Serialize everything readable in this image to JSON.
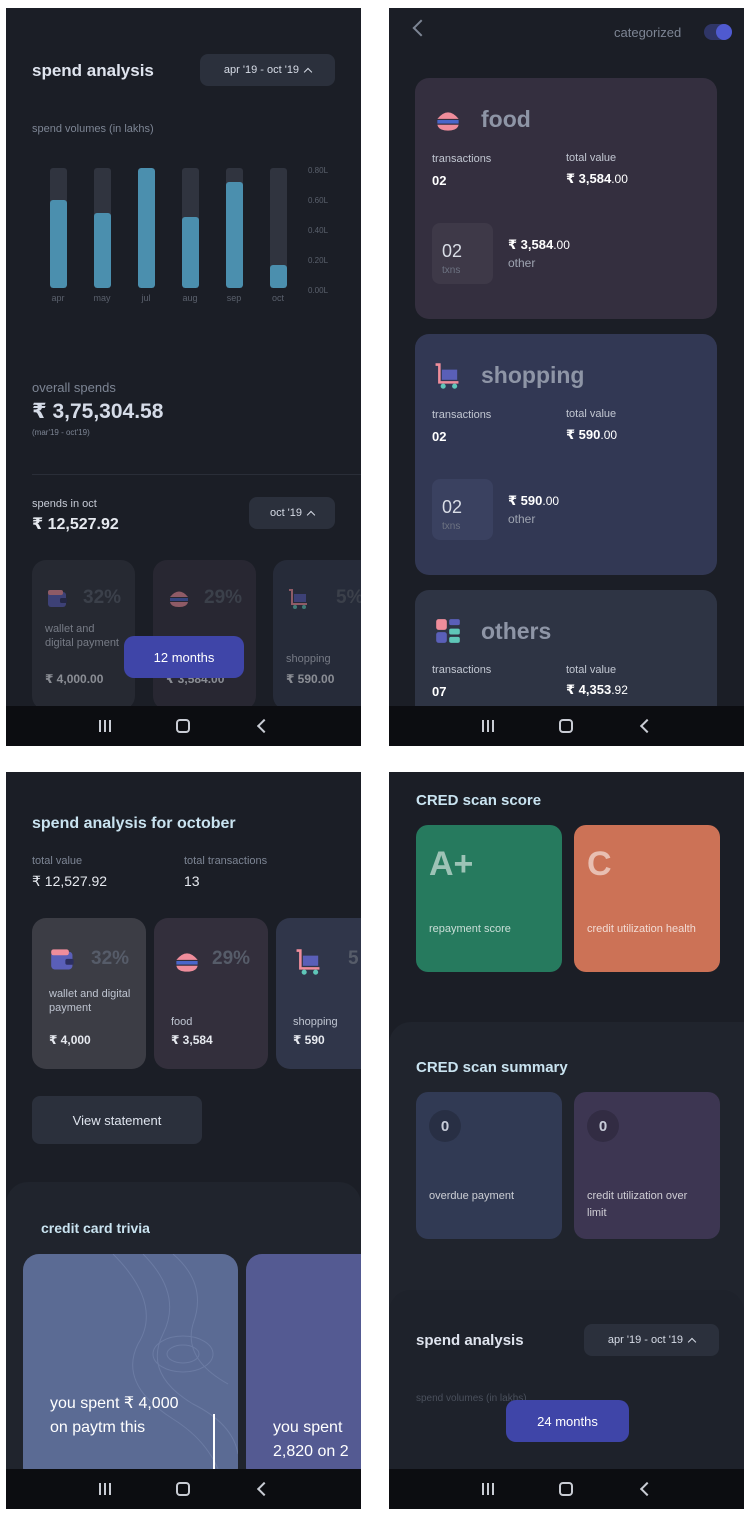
{
  "screen1": {
    "title": "spend analysis",
    "range_pill": "apr '19 - oct '19",
    "chart_label": "spend volumes (in lakhs)",
    "overall_label": "overall spends",
    "overall_value": "₹ 3,75,304.58",
    "overall_range": "(mar'19 - oct'19)",
    "month_label": "spends in oct",
    "month_value": "₹ 12,527.92",
    "month_pill": "oct '19",
    "categories": [
      {
        "pct": "32%",
        "name": "wallet and digital payment",
        "value": "₹ 4,000.00"
      },
      {
        "pct": "29%",
        "name": "food",
        "value": "₹ 3,584.00"
      },
      {
        "pct": "5%",
        "name": "shopping",
        "value": "₹ 590.00"
      }
    ],
    "float_button": "12 months"
  },
  "chart_data": {
    "type": "bar",
    "categories": [
      "apr",
      "may",
      "jul",
      "aug",
      "sep",
      "oct"
    ],
    "values": [
      0.59,
      0.5,
      0.8,
      0.47,
      0.71,
      0.15
    ],
    "yticks": [
      "0.80L",
      "0.60L",
      "0.40L",
      "0.20L",
      "0.00L"
    ],
    "ylim": [
      0,
      0.8
    ],
    "title": "",
    "ylabel": "spend volumes (in lakhs)",
    "xlabel": "",
    "grid": false
  },
  "screen2": {
    "toggle_label": "categorized",
    "cards": [
      {
        "name": "food",
        "tx_label": "transactions",
        "tx_value": "02",
        "tv_label": "total value",
        "tv_main": "₹ 3,584",
        "tv_dec": ".00",
        "box_num": "02",
        "box_lbl": "txns",
        "sub_main": "₹ 3,584",
        "sub_dec": ".00",
        "sub_lbl": "other"
      },
      {
        "name": "shopping",
        "tx_label": "transactions",
        "tx_value": "02",
        "tv_label": "total value",
        "tv_main": "₹ 590",
        "tv_dec": ".00",
        "box_num": "02",
        "box_lbl": "txns",
        "sub_main": "₹ 590",
        "sub_dec": ".00",
        "sub_lbl": "other"
      },
      {
        "name": "others",
        "tx_label": "transactions",
        "tx_value": "07",
        "tv_label": "total value",
        "tv_main": "₹ 4,353",
        "tv_dec": ".92"
      }
    ]
  },
  "screen3": {
    "title": "spend analysis for october",
    "total_value_label": "total value",
    "total_value": "₹ 12,527.92",
    "total_tx_label": "total transactions",
    "total_tx": "13",
    "categories": [
      {
        "pct": "32%",
        "name": "wallet and digital payment",
        "value": "₹ 4,000"
      },
      {
        "pct": "29%",
        "name": "food",
        "value": "₹ 3,584"
      },
      {
        "pct": "5",
        "name": "shopping",
        "value": "₹ 590"
      }
    ],
    "view_button": "View statement",
    "trivia_title": "credit card trivia",
    "trivia_1": "you spent ₹ 4,000 on paytm this",
    "trivia_2": "you spent 2,820 on 2"
  },
  "screen4": {
    "score_title": "CRED scan score",
    "scores": [
      {
        "grade": "A+",
        "label": "repayment score",
        "color": "#267a5e"
      },
      {
        "grade": "C",
        "label": "credit utilization health",
        "color": "#cc7256"
      }
    ],
    "summary_title": "CRED scan summary",
    "summary": [
      {
        "value": "0",
        "label": "overdue payment"
      },
      {
        "value": "0",
        "label": "credit utilization over limit"
      }
    ],
    "spend_title": "spend analysis",
    "spend_pill": "apr '19 - oct '19",
    "spend_sub": "spend volumes (in lakhs)",
    "float_button": "24 months"
  },
  "colors": {
    "background": "#1b1e26",
    "bar": "#4b8fae",
    "accent_button": "#3f45a8",
    "food_card": "#342f3f",
    "shopping_card": "#323854",
    "others_card": "#2e3444"
  }
}
